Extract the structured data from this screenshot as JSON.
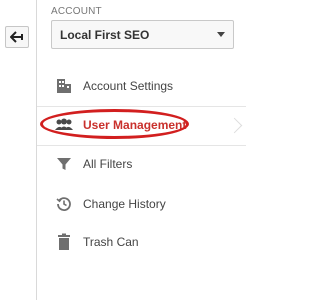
{
  "account": {
    "label": "ACCOUNT",
    "selected": "Local First SEO"
  },
  "nav": {
    "items": [
      {
        "label": "Account Settings",
        "icon": "building-icon",
        "active": false
      },
      {
        "label": "User Management",
        "icon": "users-icon",
        "active": true
      },
      {
        "label": "All Filters",
        "icon": "filter-icon",
        "active": false
      },
      {
        "label": "Change History",
        "icon": "history-icon",
        "active": false
      },
      {
        "label": "Trash Can",
        "icon": "trash-icon",
        "active": false
      }
    ]
  },
  "colors": {
    "active_text": "#c9302c",
    "highlight_oval": "#d21f1f",
    "icon_gray": "#6f6f6f"
  }
}
